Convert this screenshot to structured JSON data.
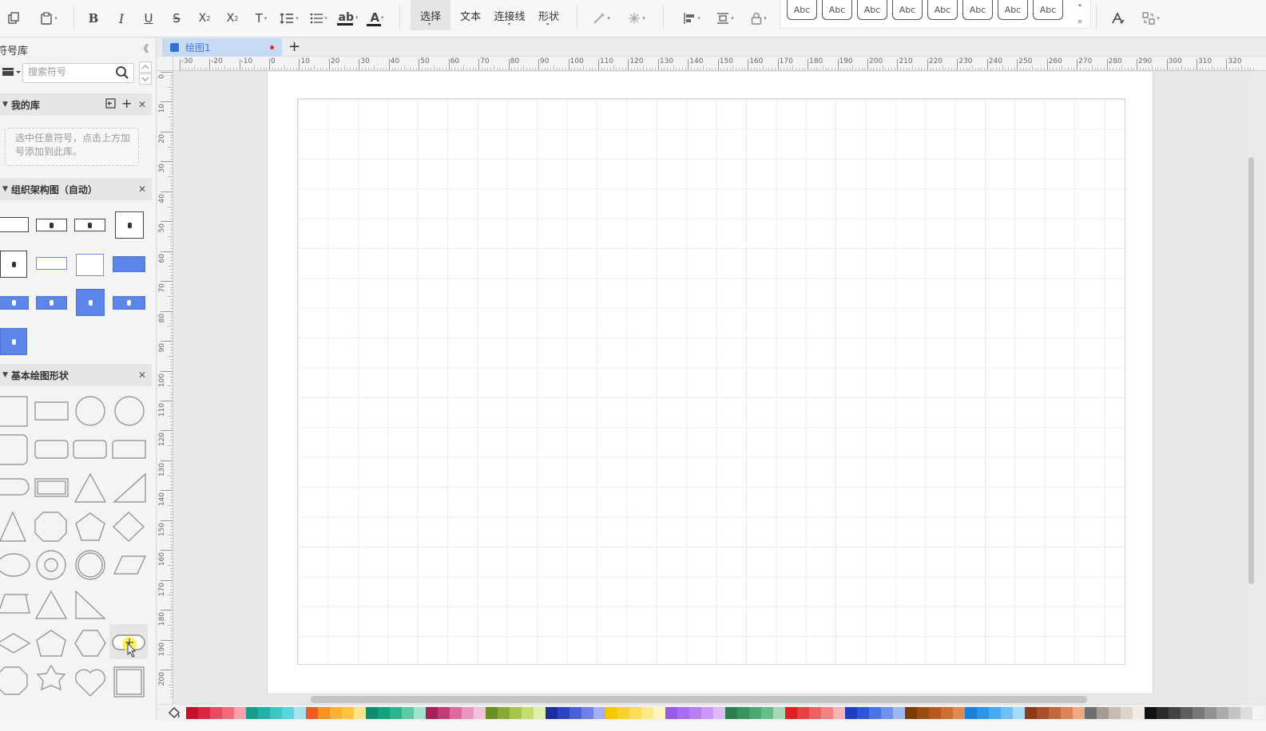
{
  "toolbar": {
    "modes": [
      {
        "label": "选择",
        "active": true
      },
      {
        "label": "文本",
        "active": false
      },
      {
        "label": "连接线",
        "active": false
      },
      {
        "label": "形状",
        "active": false
      }
    ],
    "style_presets": [
      "Abc",
      "Abc",
      "Abc",
      "Abc",
      "Abc",
      "Abc",
      "Abc",
      "Abc"
    ]
  },
  "sidebar": {
    "title": "符号库",
    "search_placeholder": "搜索符号",
    "sections": {
      "my_library": {
        "title": "我的库",
        "empty_hint": "选中任意符号，点击上方加号添加到此库。"
      },
      "org_chart": {
        "title": "组织架构图（自动）"
      },
      "basic_shapes": {
        "title": "基本绘图形状"
      }
    }
  },
  "document": {
    "tab_name": "绘图1",
    "tab_unsaved": true
  },
  "rulers": {
    "horizontal_labels": [
      "-30",
      "-20",
      "-10",
      "0",
      "10",
      "20",
      "30",
      "40",
      "50",
      "60",
      "70",
      "80",
      "90",
      "100",
      "110",
      "120",
      "130",
      "140",
      "150",
      "160",
      "170",
      "180",
      "190",
      "200",
      "210",
      "220",
      "230",
      "240",
      "250",
      "260",
      "270",
      "280",
      "290",
      "300",
      "310",
      "320"
    ],
    "vertical_labels": [
      "0",
      "10",
      "20",
      "30",
      "40",
      "50",
      "60",
      "70",
      "80",
      "90",
      "100",
      "110",
      "120",
      "130",
      "140",
      "150",
      "160",
      "170",
      "180",
      "190",
      "200"
    ]
  },
  "palette": {
    "colors": [
      "#c8102e",
      "#d7263d",
      "#e84a5f",
      "#f06a7a",
      "#f7a1ab",
      "#1a9c8c",
      "#20b2aa",
      "#3ec7c1",
      "#5ed3e0",
      "#a7e3ef",
      "#f15a24",
      "#f7931e",
      "#fbb03b",
      "#fcc33d",
      "#fde38b",
      "#0f8a6a",
      "#12a27e",
      "#2db48e",
      "#5fcaa8",
      "#a4e2cc",
      "#a51f5a",
      "#c33c7a",
      "#dc6aa0",
      "#e896c0",
      "#f3c2dc",
      "#6b8e23",
      "#8aa936",
      "#a8c44b",
      "#c5dd6e",
      "#e2efaa",
      "#1f2d9c",
      "#2e44c2",
      "#4a5fd8",
      "#7280e6",
      "#a4aef1",
      "#f7c600",
      "#f9d22b",
      "#fbde55",
      "#fde985",
      "#fef4c0",
      "#9b59e8",
      "#a96bf0",
      "#b87ff5",
      "#c998f8",
      "#dcbbfb",
      "#2e7d4f",
      "#3a9260",
      "#4aa870",
      "#69bd89",
      "#a3d9b5",
      "#e02020",
      "#e84040",
      "#f06060",
      "#f48282",
      "#f9b3b3",
      "#1e3fbf",
      "#2a55d9",
      "#4a73e8",
      "#6d91ef",
      "#9fb8f5",
      "#7a3d00",
      "#9a4d10",
      "#b85a20",
      "#cf6e33",
      "#e08a55",
      "#1e7fd9",
      "#2a95ea",
      "#45aaf2",
      "#6cc0f6",
      "#a6dbfa",
      "#8b3a1a",
      "#a84e2a",
      "#c4673e",
      "#dc8456",
      "#eeaa82",
      "#6f6f6f",
      "#a89a8c",
      "#c7bcb0",
      "#ddd4ca",
      "#f0ebe5",
      "#111111",
      "#2b2b2b",
      "#444444",
      "#5e5e5e",
      "#777777",
      "#919191",
      "#ababab",
      "#c4c4c4",
      "#dedede",
      "#f5f5f5"
    ]
  }
}
